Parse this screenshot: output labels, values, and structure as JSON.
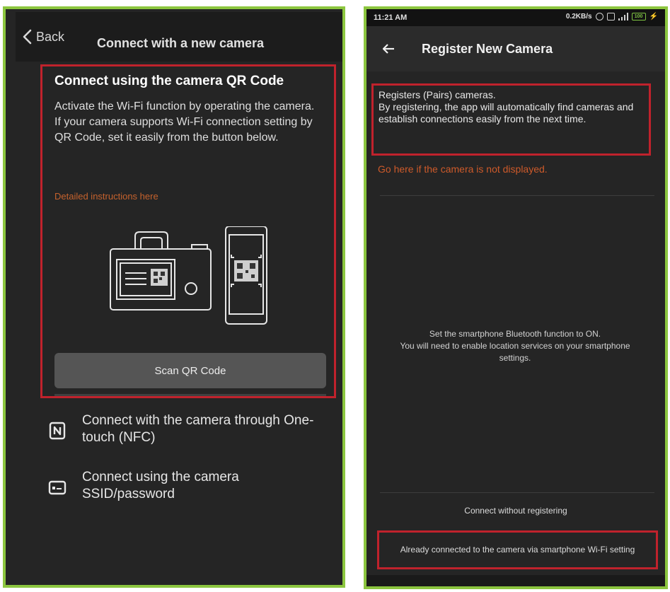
{
  "left_screen": {
    "back_label": "Back",
    "title": "Connect with a new camera",
    "qr_section": {
      "heading": "Connect using the camera QR Code",
      "description": "Activate the Wi-Fi function by operating the camera.\nIf your camera supports Wi-Fi connection setting by QR Code, set it easily from the button below.",
      "instructions_link": "Detailed instructions here",
      "scan_button": "Scan QR Code"
    },
    "options": [
      {
        "icon": "nfc-icon",
        "label": "Connect with the camera through One-touch (NFC)"
      },
      {
        "icon": "ssid-card-icon",
        "label": "Connect using the camera SSID/password"
      }
    ]
  },
  "right_screen": {
    "status_bar": {
      "time": "11:21 AM",
      "network_speed": "0.2KB/s",
      "battery": "100"
    },
    "title": "Register New Camera",
    "register_text": "Registers (Pairs) cameras.\nBy registering, the app will automatically find cameras and establish connections easily from the next time.",
    "not_displayed_link": "Go here if the camera is not displayed.",
    "bluetooth_text": "Set the smartphone Bluetooth function to ON.\nYou will need to enable location services on your smartphone settings.",
    "connect_without_registering": "Connect without registering",
    "already_connected": "Already connected to the camera via smartphone Wi-Fi setting"
  },
  "colors": {
    "highlight_border": "#c0222c",
    "panel_border": "#8cc63f",
    "link_orange": "#cd5a2a",
    "background": "#252525"
  }
}
